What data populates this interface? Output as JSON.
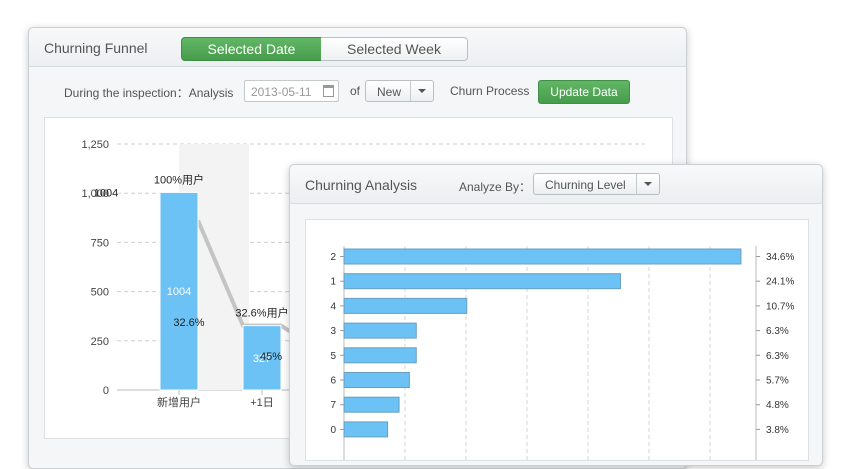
{
  "funnel": {
    "title": "Churning Funnel",
    "tab_selected_date": "Selected Date",
    "tab_selected_week": "Selected Week",
    "inspection_label": "During the inspection：Analysis",
    "date_value": "2013-05-11",
    "of_label": "of",
    "type_value": "New",
    "churn_process_label": "Churn Process",
    "update_button": "Update Data"
  },
  "analysis": {
    "title": "Churning Analysis",
    "analyze_by_label": "Analyze By：",
    "analyze_by_value": "Churning Level"
  },
  "chart_data": [
    {
      "type": "bar",
      "title": "",
      "ylim": [
        0,
        1250
      ],
      "yticks": [
        "0",
        "250",
        "500",
        "750",
        "1,000",
        "1,250"
      ],
      "ytick_values": [
        0,
        250,
        500,
        750,
        1000,
        1250
      ],
      "categories": [
        "新增用户",
        "+1日"
      ],
      "values": [
        1004,
        327
      ],
      "top_labels": [
        "100%用户",
        "32.6%用户"
      ],
      "inner_labels": [
        "1004",
        "327"
      ],
      "outside_labels": [
        "1004"
      ],
      "rate_labels": [
        "32.6%",
        "45%"
      ],
      "bar_color": "#6cc2f5",
      "grid": true
    },
    {
      "type": "bar",
      "orientation": "horizontal",
      "categories": [
        "2",
        "1",
        "4",
        "3",
        "5",
        "6",
        "7",
        "0"
      ],
      "values": [
        34.6,
        24.1,
        10.7,
        6.3,
        6.3,
        5.7,
        4.8,
        3.8
      ],
      "value_labels": [
        "34.6%",
        "24.1%",
        "10.7%",
        "6.3%",
        "6.3%",
        "5.7%",
        "4.8%",
        "3.8%"
      ],
      "bar_color": "#6cc2f5",
      "grid": true
    }
  ]
}
